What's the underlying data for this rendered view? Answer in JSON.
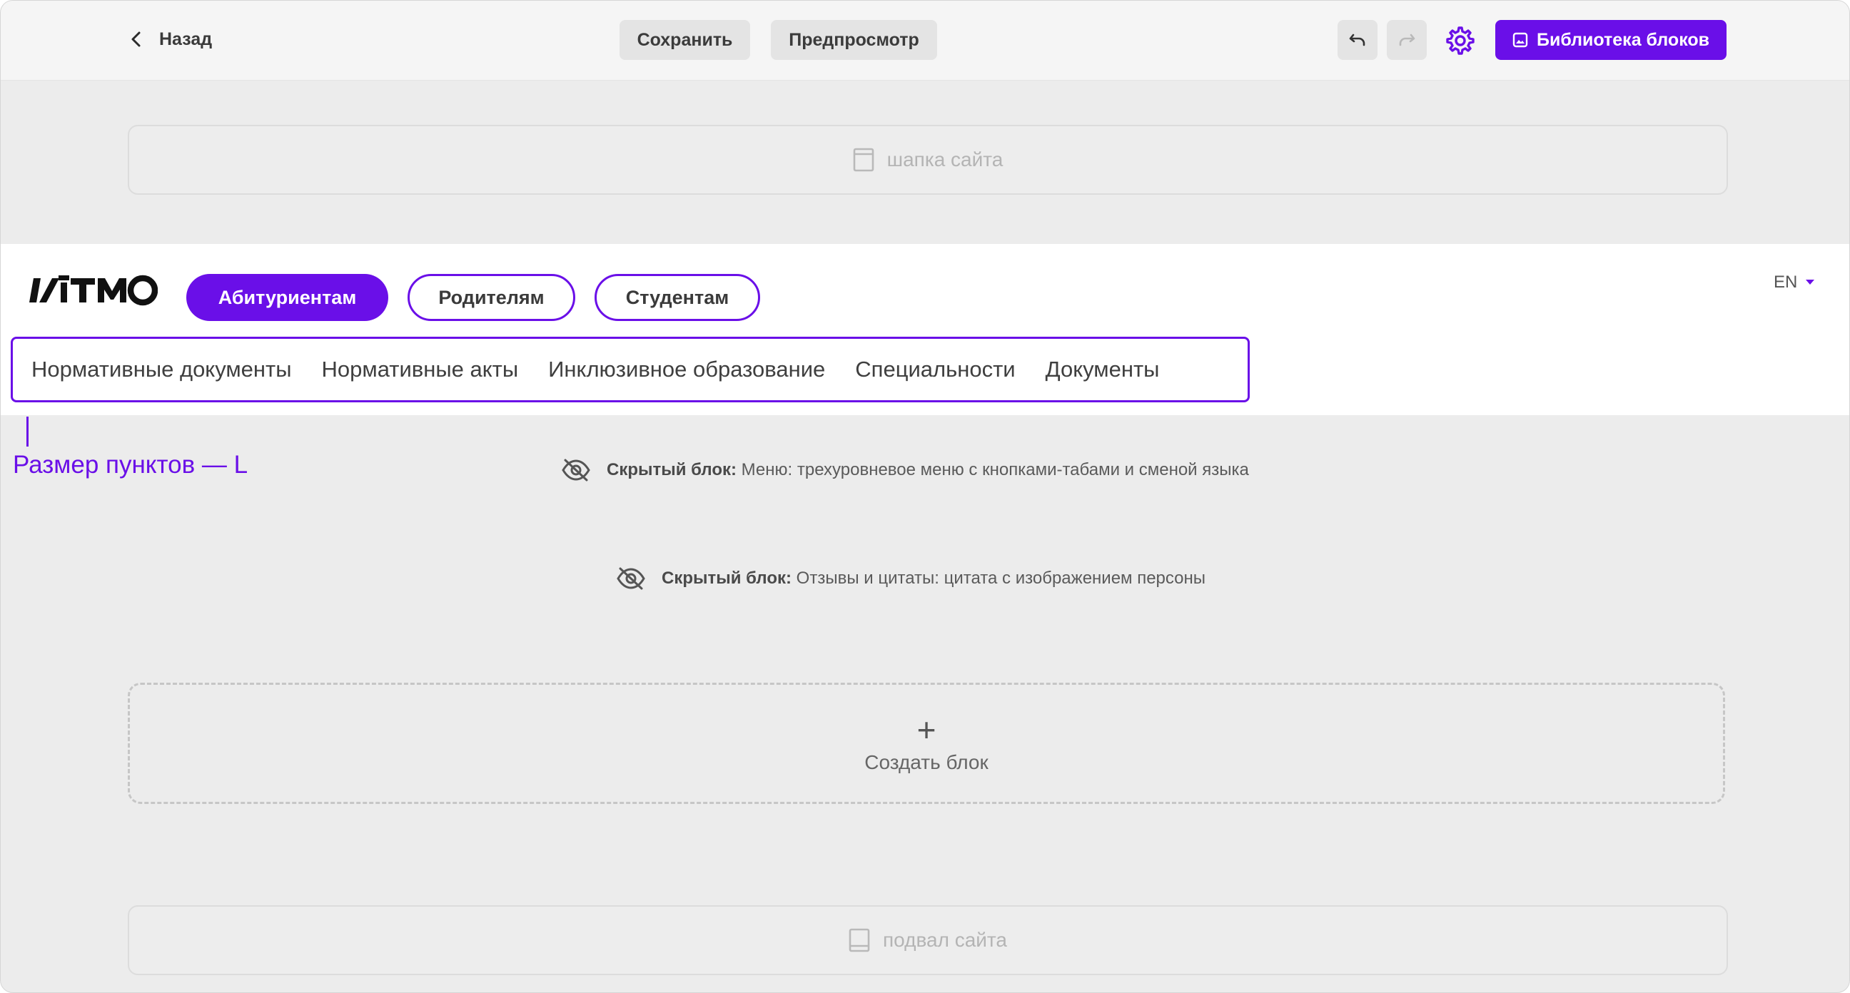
{
  "toolbar": {
    "back_label": "Назад",
    "save_label": "Сохранить",
    "preview_label": "Предпросмотр",
    "library_label": "Библиотека блоков"
  },
  "placeholders": {
    "header_label": "шапка сайта",
    "footer_label": "подвал сайта"
  },
  "site_header": {
    "tabs": [
      "Абитуриентам",
      "Родителям",
      "Студентам"
    ],
    "active_tab": "Абитуриентам",
    "language": "EN",
    "menu_items": [
      "Нормативные документы",
      "Нормативные акты",
      "Инклюзивное образование",
      "Специальности",
      "Документы"
    ]
  },
  "annotation": {
    "text": "Размер пунктов — L"
  },
  "hidden_blocks": [
    {
      "prefix": "Скрытый блок:",
      "description": "Меню: трехуровневое меню с кнопками-табами и сменой языка"
    },
    {
      "prefix": "Скрытый блок:",
      "description": "Отзывы и цитаты: цитата с изображением персоны"
    }
  ],
  "create_block": {
    "plus": "+",
    "label": "Создать блок"
  },
  "colors": {
    "accent": "#6a0fe8",
    "canvas": "#ececec",
    "toolbar": "#f5f5f5"
  },
  "icons": [
    "chevron-left-icon",
    "undo-icon",
    "redo-icon",
    "gear-icon",
    "image-icon",
    "page-icon",
    "eye-off-icon",
    "caret-down-icon"
  ]
}
